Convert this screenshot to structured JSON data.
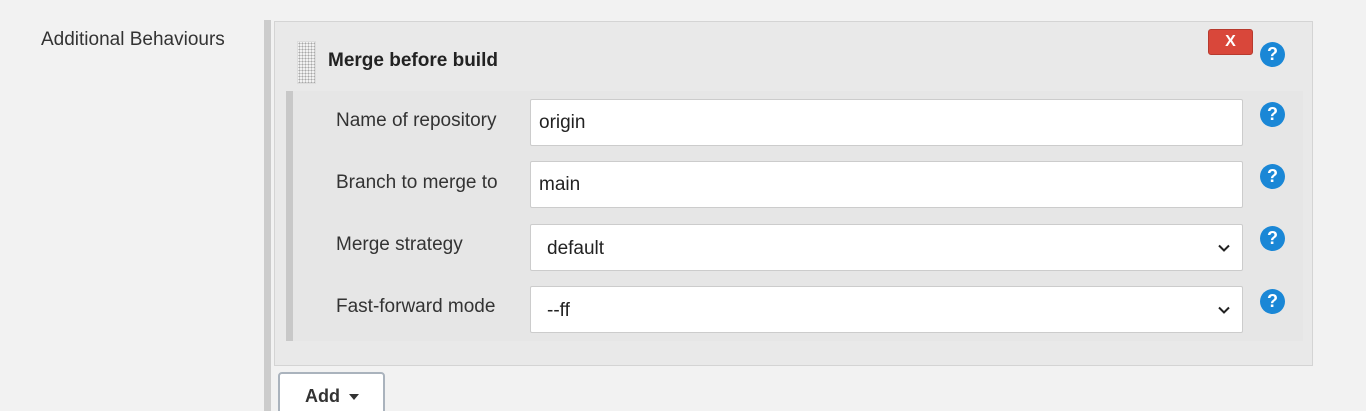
{
  "section": {
    "label": "Additional Behaviours"
  },
  "behaviour": {
    "title": "Merge before build",
    "delete_label": "X",
    "help_glyph": "?"
  },
  "fields": [
    {
      "label": "Name of repository",
      "value": "origin",
      "kind": "text"
    },
    {
      "label": "Branch to merge to",
      "value": "main",
      "kind": "text"
    },
    {
      "label": "Merge strategy",
      "value": "default",
      "kind": "select"
    },
    {
      "label": "Fast-forward mode",
      "value": "--ff",
      "kind": "select"
    }
  ],
  "add_button": {
    "label": "Add"
  },
  "icons": {
    "help": "help-icon",
    "delete": "close-icon",
    "dropdown": "chevron-down-icon",
    "drag": "drag-handle-icon"
  },
  "colors": {
    "help_blue": "#1a87d6",
    "delete_red": "#d9473a",
    "background": "#f2f2f2"
  }
}
